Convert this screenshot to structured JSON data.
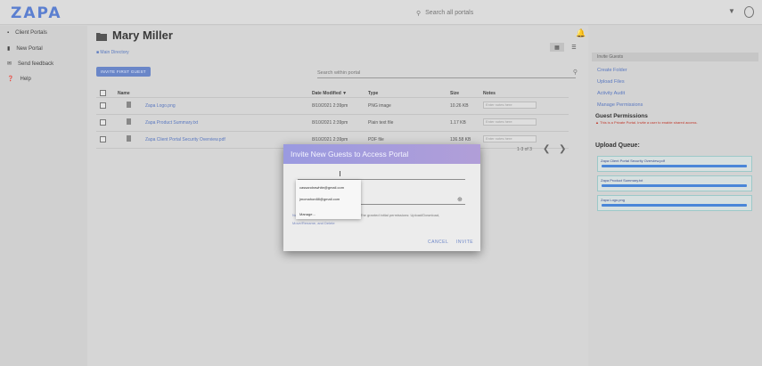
{
  "app": {
    "logo": "ZAPA",
    "search_placeholder": "Search all portals"
  },
  "sidebar": {
    "items": [
      {
        "label": "Client Portals",
        "icon": "portals-icon"
      },
      {
        "label": "New Portal",
        "icon": "new-folder-icon"
      },
      {
        "label": "Send feedback",
        "icon": "feedback-icon"
      },
      {
        "label": "Help",
        "icon": "help-icon"
      }
    ]
  },
  "main": {
    "title": "Mary Miller",
    "breadcrumb": "Main Directory",
    "invite_button": "INVITE FIRST GUEST",
    "search_placeholder": "Search within portal",
    "columns": {
      "name": "Name",
      "date": "Date Modified",
      "type": "Type",
      "size": "Size",
      "notes": "Notes"
    },
    "files": [
      {
        "name": "Zapa Logo.png",
        "date": "8/10/2021 2:39pm",
        "type": "PNG image",
        "size": "10.26 KB",
        "note_placeholder": "Enter notes here"
      },
      {
        "name": "Zapa Product Summary.txt",
        "date": "8/10/2021 2:39pm",
        "type": "Plain text file",
        "size": "1.17 KB",
        "note_placeholder": "Enter notes here"
      },
      {
        "name": "Zapa Client Portal Security Overview.pdf",
        "date": "8/10/2021 2:39pm",
        "type": "PDF file",
        "size": "136.58 KB",
        "note_placeholder": "Enter notes here"
      }
    ],
    "pagination": "1-3 of 3"
  },
  "right_panel": {
    "links": [
      "Invite Guests",
      "Create Folder",
      "Upload Files",
      "Activity Audit",
      "Manage Permissions"
    ],
    "guest_permissions_heading": "Guest Permissions",
    "guest_permissions_warning": "This is a Private Portal. Invite a user to enable shared access.",
    "upload_queue_heading": "Upload Queue:",
    "queue": [
      {
        "name": "Zapa Client Portal Security Overview.pdf"
      },
      {
        "name": "Zapa Product Summary.txt"
      },
      {
        "name": "Zapa Logo.png"
      }
    ],
    "colors": {
      "link": "#5a78c0",
      "progress": "#4a86d8"
    }
  },
  "modal": {
    "title": "Invite New Guests to Access Portal",
    "suggestions": [
      "cassandrawhite@gmail.com",
      "jmcmahon88@gmail.com"
    ],
    "manage_label": "Manage...",
    "permissions_left": "Nor",
    "permissions_text": "The granted initial permissions: Upload/Download,",
    "permissions_line2": "Move/Rename, and Delete",
    "cancel": "CANCEL",
    "invite": "INVITE",
    "header_gradient": [
      "#9a9ae0",
      "#b19ed8"
    ]
  }
}
